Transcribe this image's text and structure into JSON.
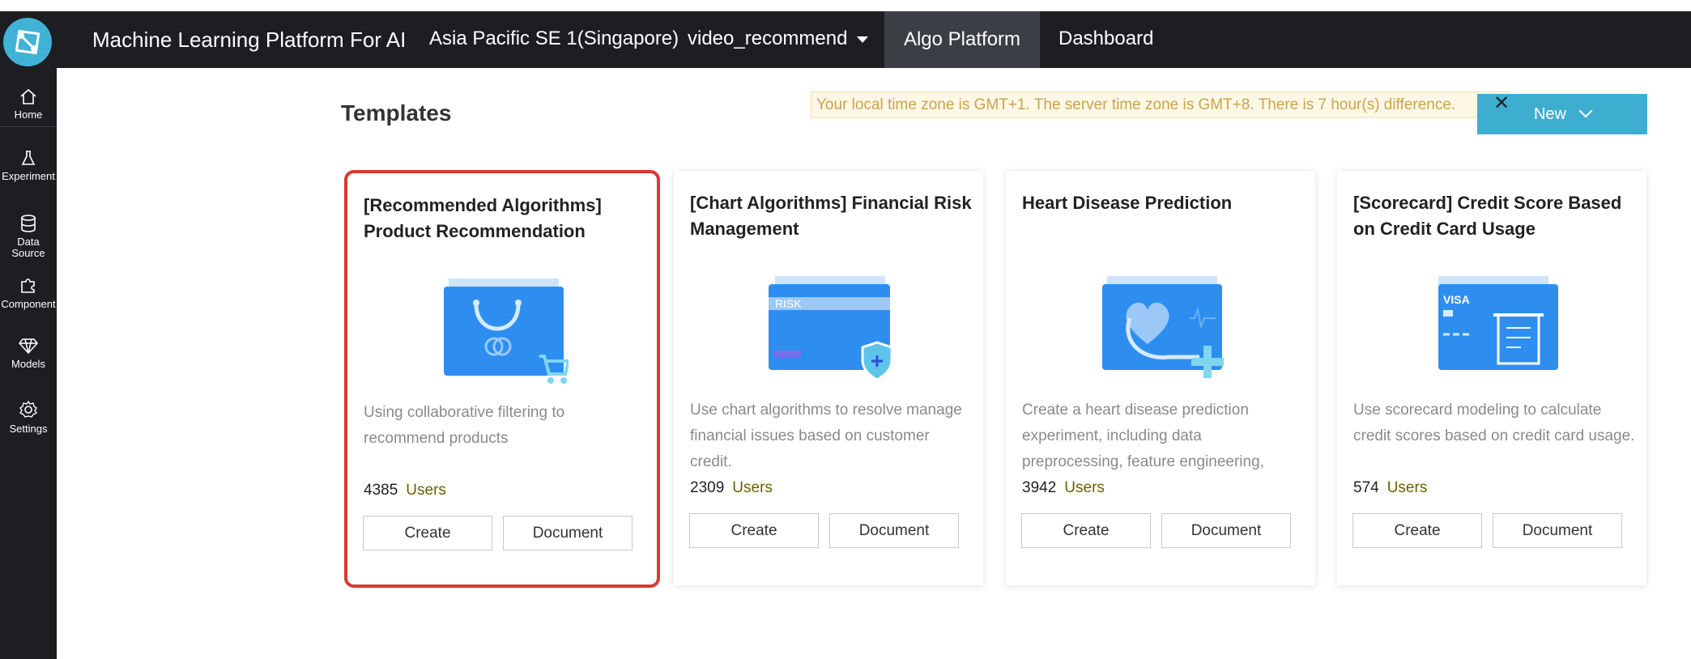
{
  "header": {
    "app_title": "Machine Learning Platform For AI",
    "region": "Asia Pacific SE 1(Singapore)",
    "project": "video_recommend",
    "nav": [
      "Algo Platform",
      "Dashboard"
    ]
  },
  "sidebar": {
    "items": [
      {
        "label": "Home",
        "icon": "home-icon"
      },
      {
        "label": "Experiment",
        "icon": "flask-icon"
      },
      {
        "label": "Data Source",
        "icon": "database-icon"
      },
      {
        "label": "Component",
        "icon": "puzzle-icon"
      },
      {
        "label": "Models",
        "icon": "diamond-icon"
      },
      {
        "label": "Settings",
        "icon": "gear-icon"
      }
    ]
  },
  "main": {
    "title": "Templates",
    "timezone_notice": "Your local time zone is GMT+1. The server time zone is GMT+8. There is 7 hour(s) difference.",
    "new_button": "New"
  },
  "cards": [
    {
      "title": "[Recommended Algorithms] Product Recommendation",
      "description": "Using collaborative filtering to recommend products",
      "users_count": "4385",
      "users_label": "Users",
      "create_label": "Create",
      "document_label": "Document",
      "icon": "shopping-bag-icon",
      "highlighted": true
    },
    {
      "title": "[Chart Algorithms] Financial Risk Management",
      "description": "Use chart algorithms to resolve manage financial issues based on customer credit.",
      "users_count": "2309",
      "users_label": "Users",
      "create_label": "Create",
      "document_label": "Document",
      "icon": "risk-card-icon",
      "card_text": "RISK"
    },
    {
      "title": "Heart Disease Prediction",
      "description": "Create a heart disease prediction experiment, including data preprocessing, feature engineering,",
      "users_count": "3942",
      "users_label": "Users",
      "create_label": "Create",
      "document_label": "Document",
      "icon": "heart-stethoscope-icon"
    },
    {
      "title": "[Scorecard] Credit Score Based on Credit Card Usage",
      "description": "Use scorecard modeling to calculate credit scores based on credit card usage.",
      "users_count": "574",
      "users_label": "Users",
      "create_label": "Create",
      "document_label": "Document",
      "icon": "credit-card-receipt-icon",
      "card_text": "VISA"
    }
  ],
  "colors": {
    "topbar": "#1c1e22",
    "accent": "#3eaed0",
    "highlight": "#d93a32",
    "notice_bg": "#fdf7e5",
    "notice_text": "#c9a44c"
  }
}
